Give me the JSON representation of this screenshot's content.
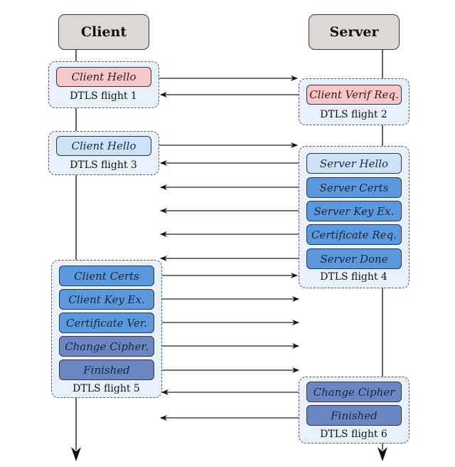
{
  "actors": {
    "client": "Client",
    "server": "Server"
  },
  "flights": [
    {
      "label": "DTLS flight 1",
      "side": "client",
      "messages": [
        {
          "text": "Client Hello",
          "color": "#f6c8c8"
        }
      ]
    },
    {
      "label": "DTLS flight 2",
      "side": "server",
      "messages": [
        {
          "text": "Client Verif Req.",
          "color": "#f6c8c8"
        }
      ]
    },
    {
      "label": "DTLS flight 3",
      "side": "client",
      "messages": [
        {
          "text": "Client Hello",
          "color": "#cce3f7"
        }
      ]
    },
    {
      "label": "DTLS flight 4",
      "side": "server",
      "messages": [
        {
          "text": "Server Hello",
          "color": "#cce3f7"
        },
        {
          "text": "Server Certs",
          "color": "#5b98dc"
        },
        {
          "text": "Server Key Ex.",
          "color": "#5b98dc"
        },
        {
          "text": "Certificate Req.",
          "color": "#5b98dc"
        },
        {
          "text": "Server Done",
          "color": "#5b98dc"
        }
      ]
    },
    {
      "label": "DTLS flight 5",
      "side": "client",
      "messages": [
        {
          "text": "Client Certs",
          "color": "#5b98dc"
        },
        {
          "text": "Client Key Ex.",
          "color": "#5b98dc"
        },
        {
          "text": "Certificate Ver.",
          "color": "#5b98dc"
        },
        {
          "text": "Change Cipher.",
          "color": "#6a87c2"
        },
        {
          "text": "Finished",
          "color": "#6a87c2"
        }
      ]
    },
    {
      "label": "DTLS flight 6",
      "side": "server",
      "messages": [
        {
          "text": "Change Cipher",
          "color": "#6a87c2"
        },
        {
          "text": "Finished",
          "color": "#6a87c2"
        }
      ]
    }
  ],
  "colors": {
    "actor_fill": "#dcd9d7",
    "flight_fill": "#e8f0fb",
    "hello_initial": "#f6c8c8",
    "hello_retry": "#cce3f7",
    "handshake": "#5b98dc",
    "finish": "#6a87c2"
  }
}
